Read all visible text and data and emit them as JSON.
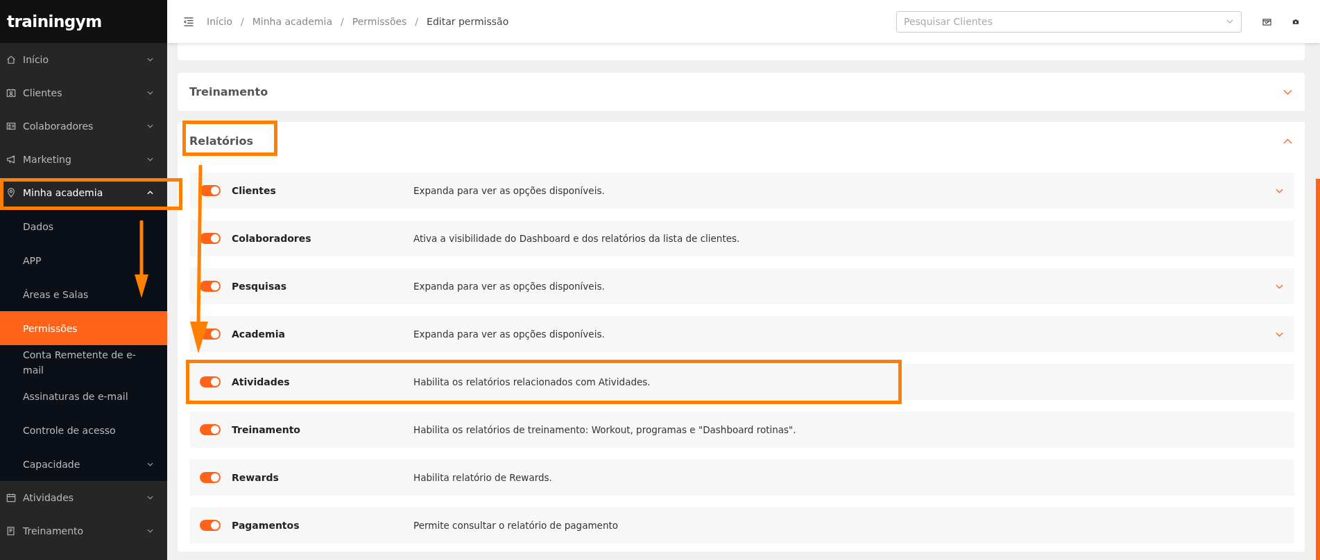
{
  "brand": "trainingym",
  "sidebar": {
    "items": [
      {
        "label": "Início",
        "expanded": false,
        "selected": false
      },
      {
        "label": "Clientes",
        "expanded": false,
        "selected": false
      },
      {
        "label": "Colaboradores",
        "expanded": false,
        "selected": false
      },
      {
        "label": "Marketing",
        "expanded": false,
        "selected": false
      },
      {
        "label": "Minha academia",
        "expanded": true,
        "selected": false,
        "children": [
          {
            "label": "Dados",
            "selected": false
          },
          {
            "label": "APP",
            "selected": false
          },
          {
            "label": "Áreas e Salas",
            "selected": false
          },
          {
            "label": "Permissões",
            "selected": true
          },
          {
            "label": "Conta Remetente de e-mail",
            "selected": false
          },
          {
            "label": "Assinaturas de e-mail",
            "selected": false
          },
          {
            "label": "Controle de acesso",
            "selected": false
          },
          {
            "label": "Capacidade",
            "selected": false,
            "expanded": false
          }
        ]
      },
      {
        "label": "Atividades",
        "expanded": false,
        "selected": false
      },
      {
        "label": "Treinamento",
        "expanded": false,
        "selected": false
      }
    ]
  },
  "breadcrumbs": [
    {
      "kind": "link",
      "text": "Início"
    },
    {
      "kind": "separator",
      "text": "/"
    },
    {
      "kind": "link",
      "text": "Minha academia"
    },
    {
      "kind": "separator",
      "text": "/"
    },
    {
      "kind": "link",
      "text": "Permissões"
    },
    {
      "kind": "separator",
      "text": "/"
    },
    {
      "kind": "current",
      "text": "Editar permissão"
    }
  ],
  "search": {
    "placeholder": "Pesquisar Clientes"
  },
  "sections": [
    {
      "title": "Treinamento",
      "expanded": false
    },
    {
      "title": "Relatórios",
      "expanded": true,
      "rows": [
        {
          "label": "Clientes",
          "description": "Expanda para ver as opções disponíveis.",
          "on": true,
          "expandable": true
        },
        {
          "label": "Colaboradores",
          "description": "Ativa a visibilidade do Dashboard e dos relatórios da lista de clientes.",
          "on": true,
          "expandable": false
        },
        {
          "label": "Pesquisas",
          "description": "Expanda para ver as opções disponíveis.",
          "on": true,
          "expandable": true
        },
        {
          "label": "Academia",
          "description": "Expanda para ver as opções disponíveis.",
          "on": true,
          "expandable": true
        },
        {
          "label": "Atividades",
          "description": "Habilita os relatórios relacionados com Atividades.",
          "on": true,
          "expandable": false
        },
        {
          "label": "Treinamento",
          "description": "Habilita os relatórios de treinamento: Workout, programas e \"Dashboard rotinas\".",
          "on": true,
          "expandable": false
        },
        {
          "label": "Rewards",
          "description": "Habilita relatório de Rewards.",
          "on": true,
          "expandable": false
        },
        {
          "label": "Pagamentos",
          "description": "Permite consultar o relatório de pagamento",
          "on": true,
          "expandable": false
        }
      ]
    }
  ]
}
